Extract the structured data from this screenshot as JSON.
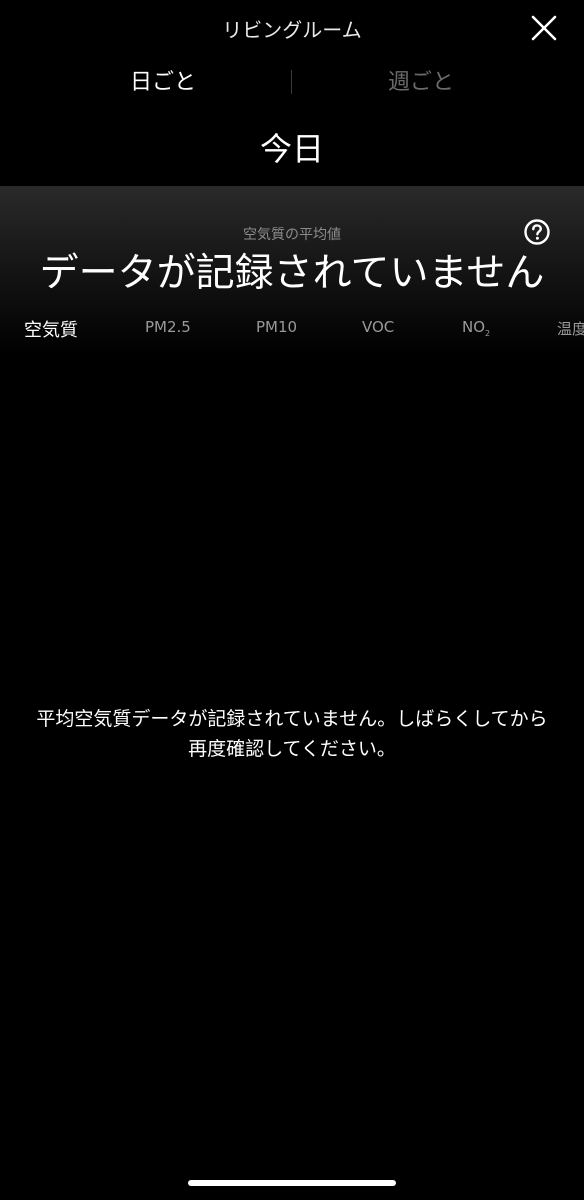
{
  "header": {
    "title": "リビングルーム"
  },
  "period_tabs": [
    {
      "label": "日ごと",
      "active": true
    },
    {
      "label": "週ごと",
      "active": false
    }
  ],
  "date_label": "今日",
  "summary": {
    "caption": "空気質の平均値",
    "main_text": "データが記録されていません"
  },
  "metric_tabs": [
    {
      "label": "空気質",
      "active": true
    },
    {
      "label": "PM2.5",
      "active": false
    },
    {
      "label": "PM10",
      "active": false
    },
    {
      "label": "VOC",
      "active": false
    },
    {
      "label": "NO",
      "sub": "2",
      "active": false
    },
    {
      "label": "温度",
      "active": false
    }
  ],
  "empty_message": "平均空気質データが記録されていません。しばらくしてから再度確認してください。",
  "icons": {
    "close": "close-icon",
    "help": "help-icon"
  },
  "colors": {
    "background": "#000000",
    "active_text": "#ffffff",
    "inactive_text": "#6a6a6a"
  }
}
